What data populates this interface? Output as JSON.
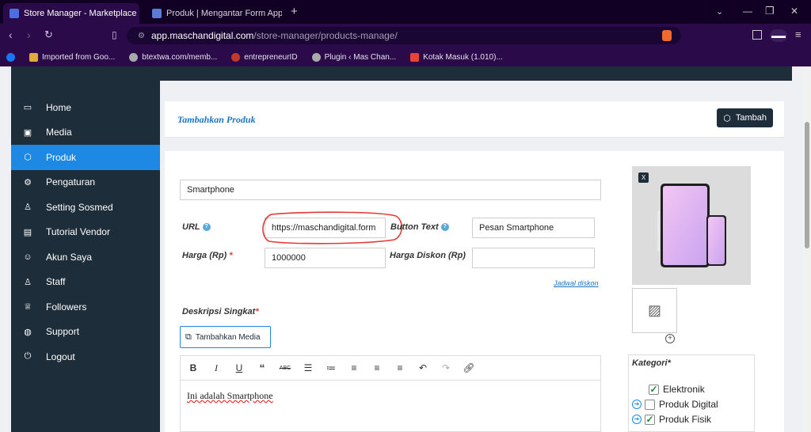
{
  "browser": {
    "tabs": [
      {
        "title": "Store Manager - Marketplace M",
        "active": true
      },
      {
        "title": "Produk | Mengantar Form App",
        "active": false
      }
    ],
    "new_tab": "+",
    "window_min": "⌄",
    "window_restore": "❐",
    "window_close": "✕",
    "url_domain": "app.maschandigital.com",
    "url_path": "/store-manager/products-manage/",
    "bookmarks": [
      {
        "label": "Imported from Goo...",
        "icon": "folder-icon"
      },
      {
        "label": "btextwa.com/memb...",
        "icon": "globe-icon"
      },
      {
        "label": "entrepreneurID",
        "icon": "entrepreneur-icon"
      },
      {
        "label": "Plugin ‹ Mas Chan...",
        "icon": "globe-icon"
      },
      {
        "label": "Kotak Masuk (1.010)...",
        "icon": "gmail-icon"
      }
    ]
  },
  "sidebar": {
    "items": [
      {
        "label": "Home",
        "icon": "monitor-icon",
        "active": false
      },
      {
        "label": "Media",
        "icon": "image-icon",
        "active": false
      },
      {
        "label": "Produk",
        "icon": "cube-icon",
        "active": true
      },
      {
        "label": "Pengaturan",
        "icon": "gear-icon",
        "active": false
      },
      {
        "label": "Setting Sosmed",
        "icon": "user-icon",
        "active": false
      },
      {
        "label": "Tutorial Vendor",
        "icon": "book-icon",
        "active": false
      },
      {
        "label": "Akun Saya",
        "icon": "users-icon",
        "active": false
      },
      {
        "label": "Staff",
        "icon": "user-icon",
        "active": false
      },
      {
        "label": "Followers",
        "icon": "trophy-icon",
        "active": false
      },
      {
        "label": "Support",
        "icon": "globe-icon",
        "active": false
      },
      {
        "label": "Logout",
        "icon": "power-icon",
        "active": false
      }
    ]
  },
  "header": {
    "title": "Tambahkan Produk",
    "add_button": "Tambah"
  },
  "form": {
    "product_name": "Smartphone",
    "url_label": "URL",
    "url_value": "https://maschandigital.form",
    "button_text_label": "Button Text",
    "button_text_value": "Pesan Smartphone",
    "price_label": "Harga (Rp)",
    "price_value": "1000000",
    "discount_label": "Harga Diskon (Rp)",
    "discount_value": "",
    "schedule_link": "Jadwal diskon",
    "short_desc_label": "Deskripsi Singkat",
    "add_media_button": "Tambahkan Media",
    "editor_text": "Ini adalah Smartphone",
    "required_mark": "*"
  },
  "sidebar_right": {
    "close_badge": "X",
    "category_title": "Kategori",
    "categories": [
      {
        "label": "Elektronik",
        "checked": true,
        "expandable": false
      },
      {
        "label": "Produk Digital",
        "checked": false,
        "expandable": true
      },
      {
        "label": "Produk Fisik",
        "checked": true,
        "expandable": true
      }
    ]
  },
  "colors": {
    "sidebar_bg": "#1e2d3a",
    "active_nav": "#1e88e5",
    "browser_bg": "#2b0a4a",
    "annotation_red": "#e53935"
  }
}
